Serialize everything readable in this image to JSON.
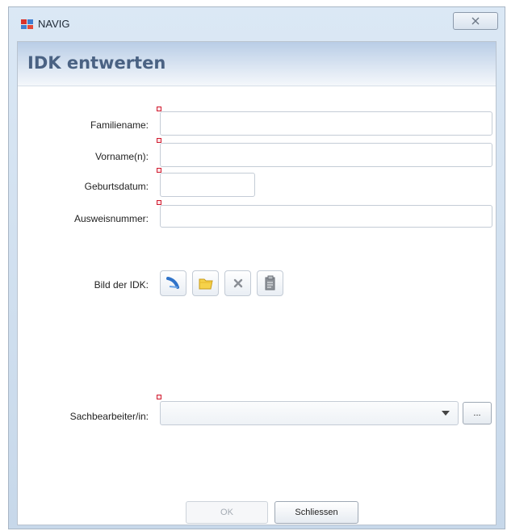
{
  "window": {
    "title": "NAVIG",
    "close_icon": "close-icon"
  },
  "dialog": {
    "title": "IDK entwerten"
  },
  "form": {
    "familienname": {
      "label": "Familiename:",
      "value": ""
    },
    "vorname": {
      "label": "Vorname(n):",
      "value": ""
    },
    "geburtsdatum": {
      "label": "Geburtsdatum:",
      "value": ""
    },
    "ausweisnummer": {
      "label": "Ausweisnummer:",
      "value": ""
    },
    "bild": {
      "label": "Bild der IDK:",
      "buttons": [
        "scan-icon",
        "folder-icon",
        "delete-icon",
        "clipboard-icon"
      ]
    },
    "sachbearbeiter": {
      "label": "Sachbearbeiter/in:",
      "value": "",
      "browse_label": "..."
    }
  },
  "footer": {
    "ok_label": "OK",
    "close_label": "Schliessen"
  },
  "colors": {
    "title_blue": "#4a6283",
    "required_red": "#d21b2f"
  }
}
